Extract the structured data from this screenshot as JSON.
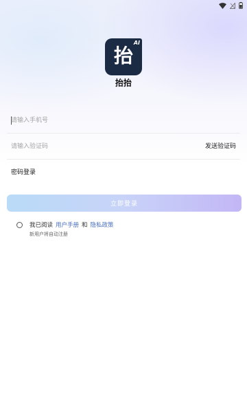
{
  "status_bar": {
    "icons": [
      "wifi-icon",
      "sim-icon",
      "battery-icon"
    ]
  },
  "logo": {
    "char": "抬",
    "badge": "AI"
  },
  "app": {
    "name": "抬抬"
  },
  "login_form": {
    "phone_placeholder": "请输入手机号",
    "phone_value": "",
    "code_placeholder": "请输入验证码",
    "code_value": "",
    "send_code_label": "发送验证码",
    "password_login_label": "密码登录",
    "login_button_label": "立即登录"
  },
  "agreement": {
    "prefix": "我已阅读",
    "user_manual": "用户手册",
    "and": "和",
    "privacy_policy": "隐私政策",
    "checked": false,
    "note": "新用户将自动注册"
  },
  "colors": {
    "logo_bg": "#1c2b44",
    "link": "#4a6fc0",
    "button_gradient_start": "#b9dbf8",
    "button_gradient_end": "#c3b7f6"
  }
}
